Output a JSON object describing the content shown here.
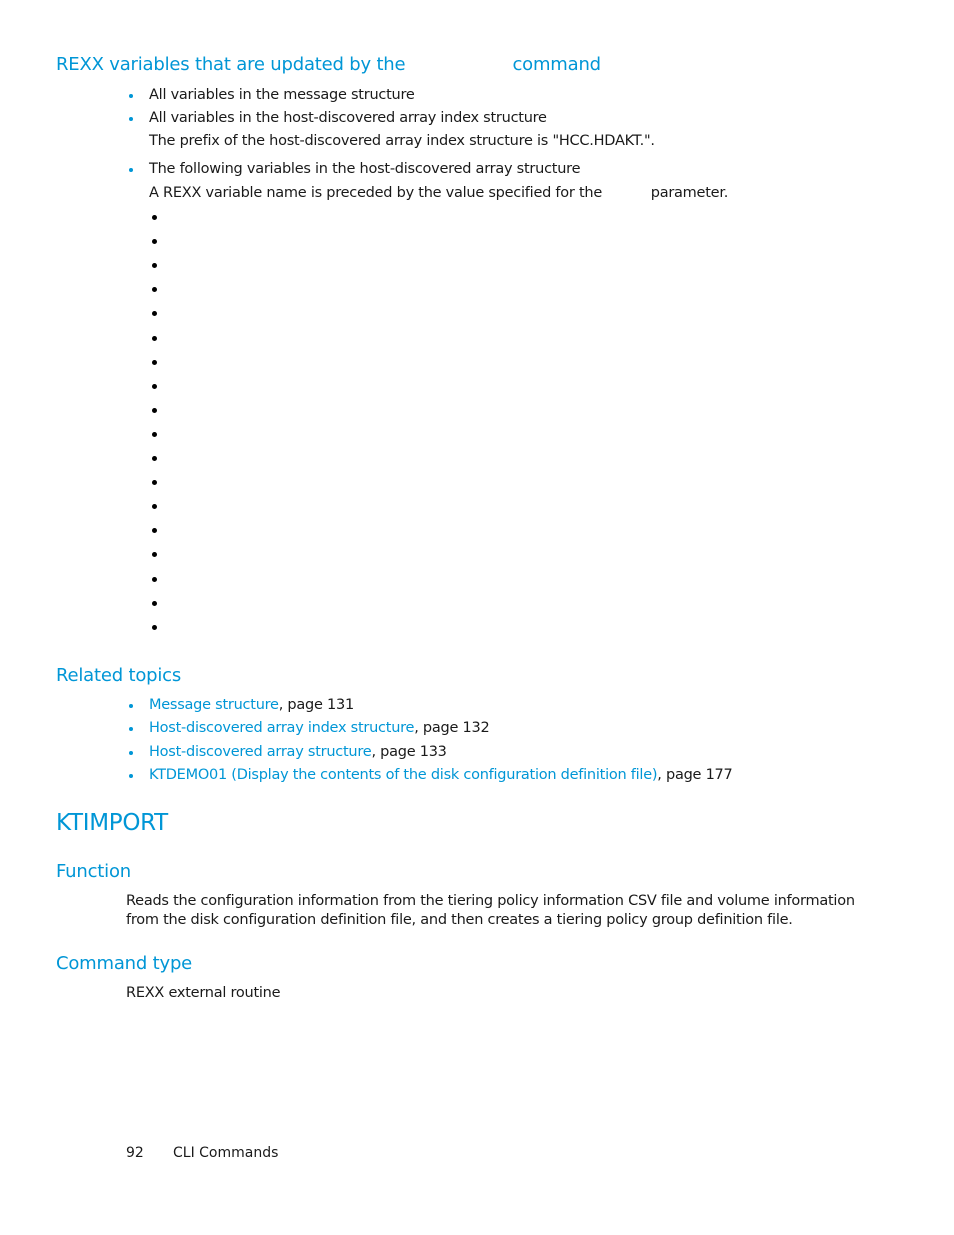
{
  "section_rexx": {
    "heading_part1": "REXX variables that are updated by the",
    "heading_part2": "command",
    "items": [
      {
        "text": "All variables in the message structure"
      },
      {
        "text": "All variables in the host-discovered array index structure",
        "note": "The prefix of the host-discovered array index structure is \"HCC.HDAKT.\"."
      },
      {
        "text": "The following variables in the host-discovered array structure",
        "note_part1": "A REXX variable name is preceded by the value specified for the",
        "note_part2": "parameter."
      }
    ],
    "empty_subbullet_count": 18
  },
  "related_topics": {
    "heading": "Related topics",
    "items": [
      {
        "link": "Message structure",
        "suffix": ", page 131"
      },
      {
        "link": "Host-discovered array index structure",
        "suffix": ", page 132"
      },
      {
        "link": "Host-discovered array structure",
        "suffix": ", page 133"
      },
      {
        "link": "KTDEMO01 (Display the contents of the disk configuration definition file)",
        "suffix": ", page 177"
      }
    ]
  },
  "ktimport": {
    "title": "KTIMPORT",
    "function_heading": "Function",
    "function_line1": "Reads the configuration information from the tiering policy information CSV file and volume information",
    "function_line2": "from the disk configuration definition file, and then creates a tiering policy group definition file.",
    "command_type_heading": "Command type",
    "command_type_value": "REXX external routine"
  },
  "footer": {
    "page_number": "92",
    "section": "CLI Commands"
  },
  "colors": {
    "accent": "#0096d6",
    "text": "#1a1a1a"
  }
}
